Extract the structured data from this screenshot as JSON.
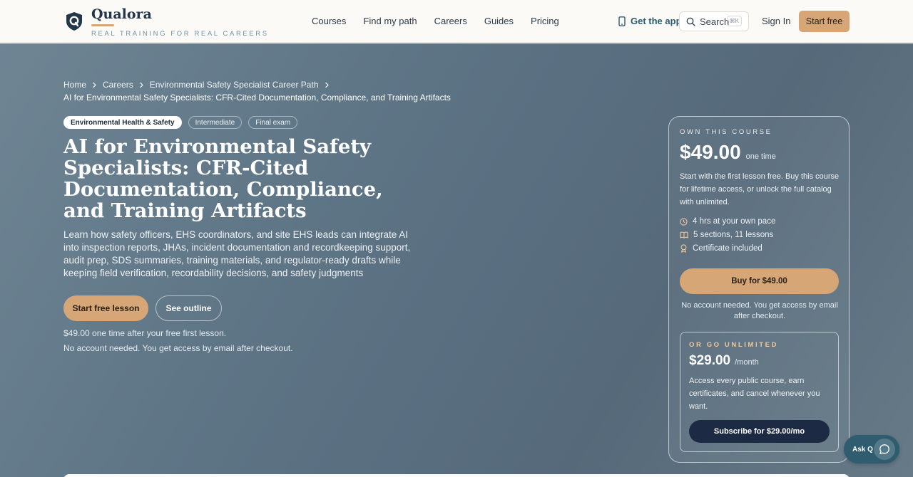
{
  "brand": {
    "name": "Qualora",
    "tagline": "REAL TRAINING FOR REAL CAREERS",
    "logo_letter": "Q"
  },
  "nav": {
    "items": [
      "Courses",
      "Find my path",
      "Careers",
      "Guides",
      "Pricing"
    ]
  },
  "header": {
    "get_app": "Get the app",
    "search_label": "Search",
    "search_shortcut": "⌘K",
    "sign_in": "Sign In",
    "start_free": "Start free"
  },
  "breadcrumb": {
    "items": [
      "Home",
      "Careers",
      "Environmental Safety Specialist Career Path"
    ],
    "current": "AI for Environmental Safety Specialists: CFR-Cited Documentation, Compliance, and Training Artifacts"
  },
  "course": {
    "tags": [
      "Environmental Health & Safety",
      "Intermediate",
      "Final exam"
    ],
    "title": "AI for Environmental Safety Specialists: CFR-Cited Documentation, Compliance, and Training Artifacts",
    "description": "Learn how safety officers, EHS coordinators, and site EHS leads can integrate AI into inspection reports, JHAs, incident documentation and recordkeeping support, audit prep, SDS summaries, training materials, and regulator-ready drafts while keeping field verification, recordability decisions, and safety judgments",
    "start_lesson": "Start free lesson",
    "see_outline": "See outline",
    "note_price": "$49.00 one time after your free first lesson.",
    "note_account": "No account needed. You get access by email after checkout."
  },
  "purchase": {
    "eyebrow": "OWN THIS COURSE",
    "price": "$49.00",
    "price_suffix": "one time",
    "description": "Start with the first lesson free. Buy this course for lifetime access, or unlock the full catalog with unlimited.",
    "features": [
      {
        "icon": "clock-icon",
        "text": "4 hrs at your own pace"
      },
      {
        "icon": "book-icon",
        "text": "5 sections, 11 lessons"
      },
      {
        "icon": "award-icon",
        "text": "Certificate included"
      }
    ],
    "buy_label": "Buy for $49.00",
    "note": "No account needed. You get access by email after checkout."
  },
  "unlimited": {
    "eyebrow": "OR GO UNLIMITED",
    "price": "$29.00",
    "price_suffix": "/month",
    "description": "Access every public course, earn certificates, and cancel whenever you want.",
    "subscribe_label": "Subscribe for $29.00/mo"
  },
  "assistant": {
    "label": "Ask Q"
  },
  "colors": {
    "accent": "#d6a677",
    "navy": "#1d2a44",
    "teal": "#2f5c6e",
    "hero": "#5e7586"
  }
}
